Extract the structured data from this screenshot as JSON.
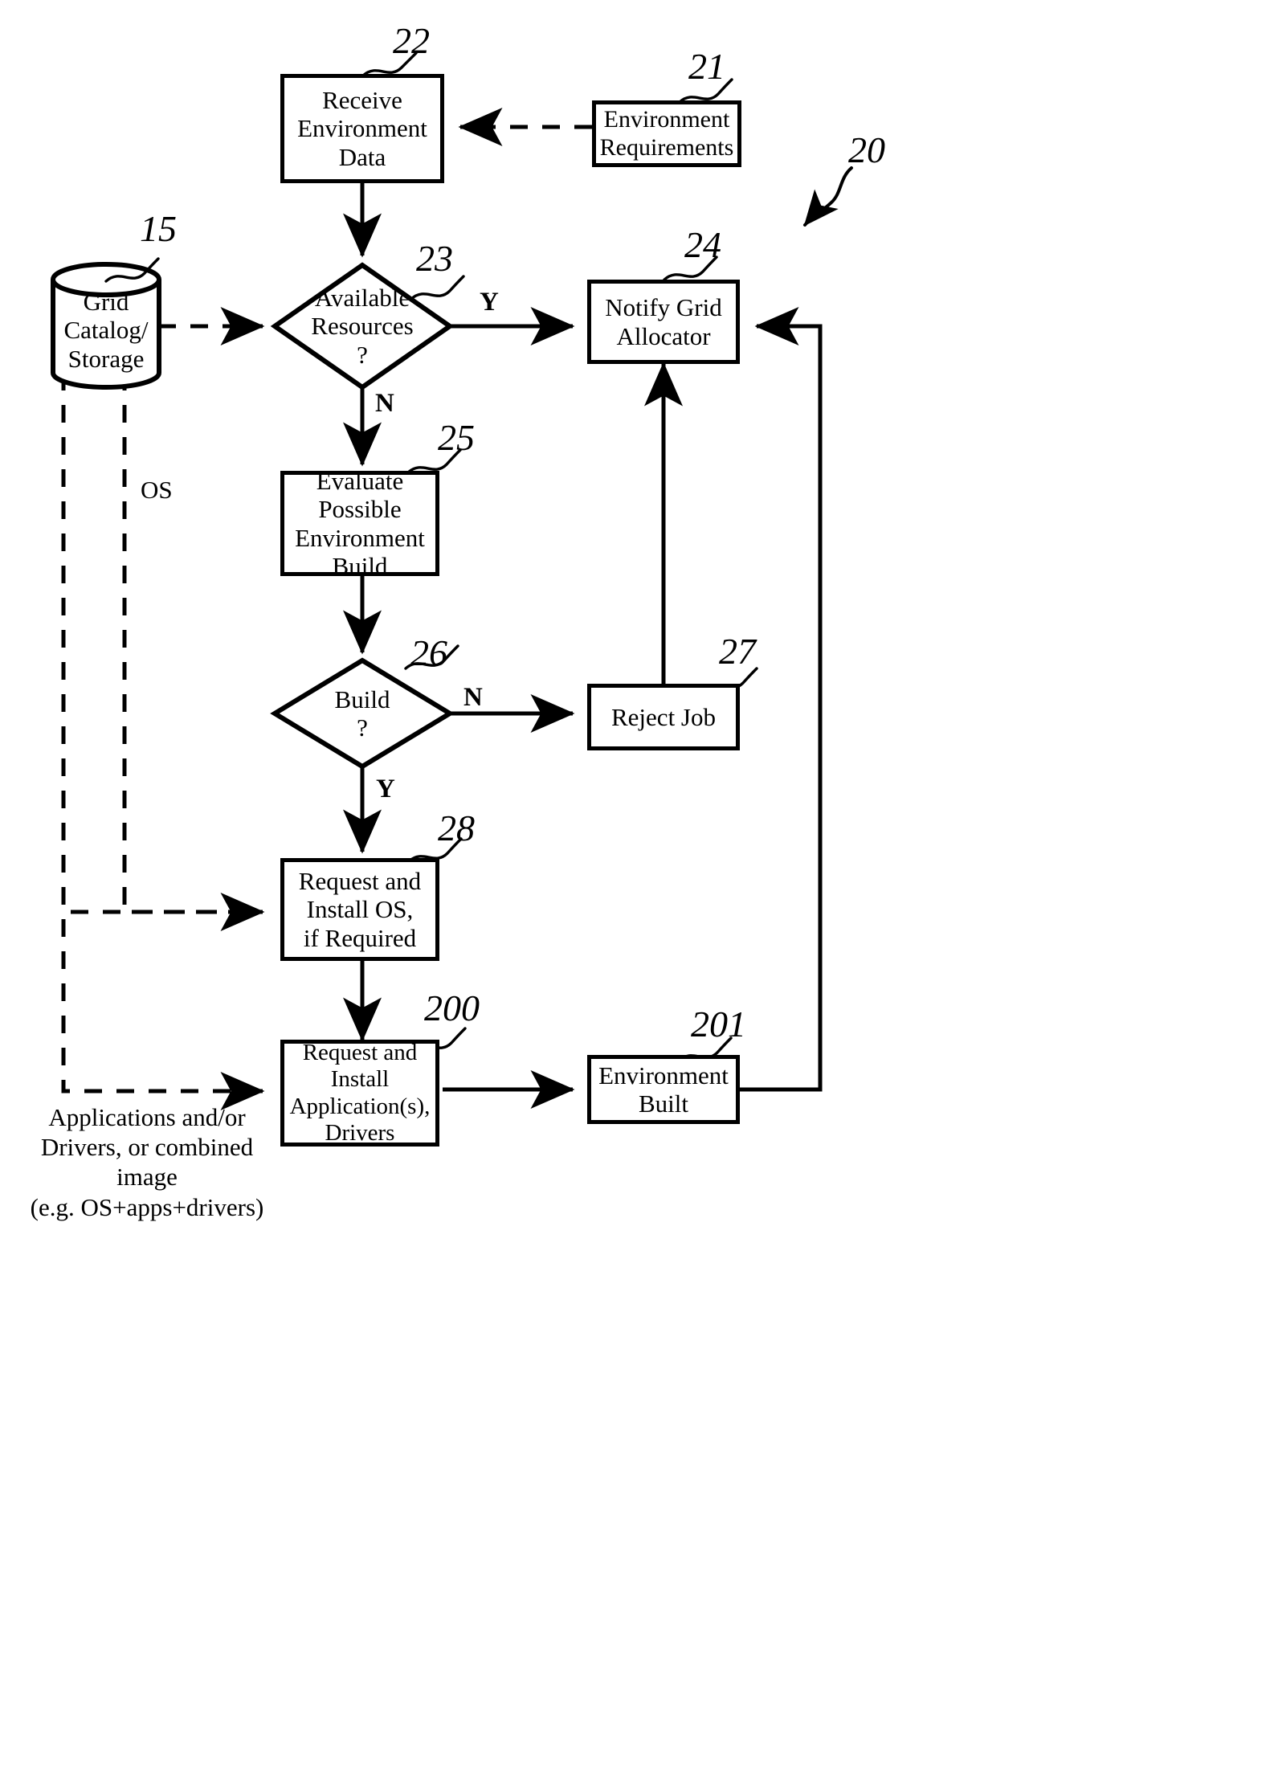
{
  "figure": {
    "type": "patent-flowchart",
    "figure_ref": "20"
  },
  "nodes": {
    "receive_env_data": {
      "label": "Receive\nEnvironment\nData",
      "ref": "22"
    },
    "environment_requirements": {
      "label": "Environment\nRequirements",
      "ref": "21"
    },
    "grid_catalog": {
      "label": "Grid\nCatalog/\nStorage",
      "ref": "15"
    },
    "available_resources": {
      "label": "Available\nResources\n?",
      "ref": "23"
    },
    "notify_grid_allocator": {
      "label": "Notify Grid\nAllocator",
      "ref": "24"
    },
    "evaluate_build": {
      "label": "Evaluate\nPossible\nEnvironment\nBuild",
      "ref": "25"
    },
    "build_decision": {
      "label": "Build\n?",
      "ref": "26"
    },
    "reject_job": {
      "label": "Reject Job",
      "ref": "27"
    },
    "request_install_os": {
      "label": "Request and\nInstall OS,\nif Required",
      "ref": "28"
    },
    "request_install_apps": {
      "label": "Request and\nInstall\nApplication(s),\nDrivers",
      "ref": "200"
    },
    "environment_built": {
      "label": "Environment\nBuilt",
      "ref": "201"
    }
  },
  "branch_labels": {
    "available_yes": "Y",
    "available_no": "N",
    "build_no": "N",
    "build_yes": "Y"
  },
  "annotations": {
    "os_flow": "OS",
    "apps_flow": "Applications and/or\nDrivers, or combined image\n(e.g. OS+apps+drivers)",
    "figure_ref": "20"
  },
  "refs": {
    "r15": "15",
    "r20": "20",
    "r21": "21",
    "r22": "22",
    "r23": "23",
    "r24": "24",
    "r25": "25",
    "r26": "26",
    "r27": "27",
    "r28": "28",
    "r200": "200",
    "r201": "201"
  },
  "colors": {
    "ink": "#000000",
    "paper": "#ffffff"
  }
}
